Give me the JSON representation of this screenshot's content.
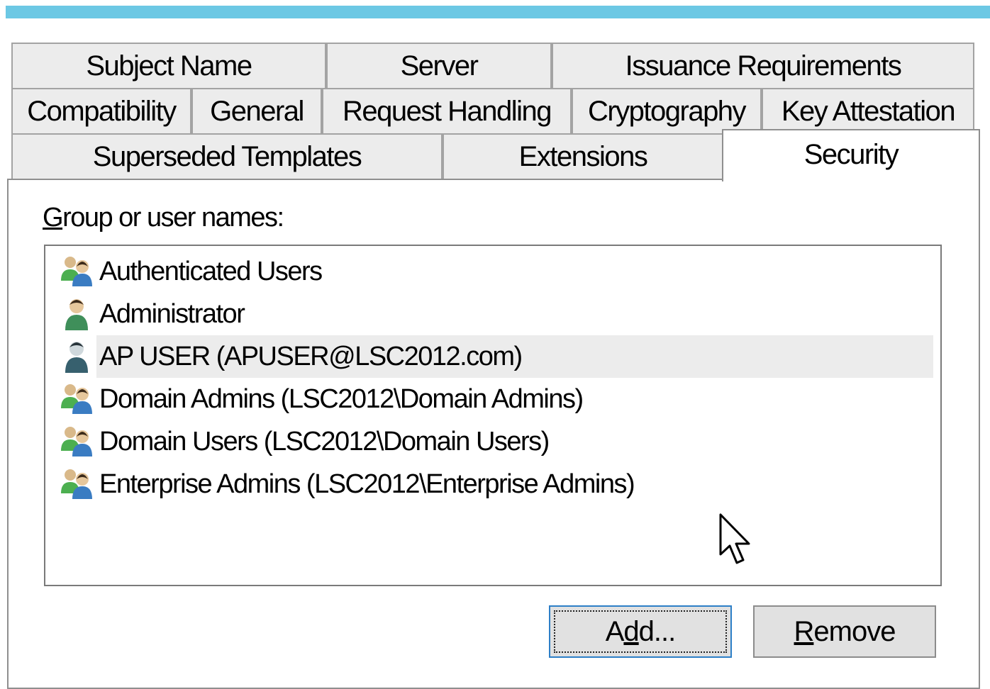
{
  "tabs": {
    "row1": [
      {
        "label": "Subject Name"
      },
      {
        "label": "Server"
      },
      {
        "label": "Issuance Requirements"
      }
    ],
    "row2": [
      {
        "label": "Compatibility"
      },
      {
        "label": "General"
      },
      {
        "label": "Request Handling"
      },
      {
        "label": "Cryptography"
      },
      {
        "label": "Key Attestation"
      }
    ],
    "row3": [
      {
        "label": "Superseded Templates"
      },
      {
        "label": "Extensions"
      },
      {
        "label": "Security",
        "active": true
      }
    ]
  },
  "security": {
    "group_label_mnemonic": "G",
    "group_label_rest": "roup or user names:",
    "principals": [
      {
        "label": "Authenticated Users",
        "icon": "group-users-icon"
      },
      {
        "label": "Administrator",
        "icon": "user-icon"
      },
      {
        "label": "AP USER (APUSER@LSC2012.com)",
        "icon": "user-icon",
        "selected": true
      },
      {
        "label": "Domain Admins (LSC2012\\Domain Admins)",
        "icon": "group-users-icon"
      },
      {
        "label": "Domain Users (LSC2012\\Domain Users)",
        "icon": "group-users-icon"
      },
      {
        "label": "Enterprise Admins (LSC2012\\Enterprise Admins)",
        "icon": "group-users-icon"
      }
    ],
    "add_button": {
      "pre": "A",
      "mnemonic": "d",
      "post": "d..."
    },
    "remove_button": {
      "mnemonic": "R",
      "post": "emove"
    }
  },
  "colors": {
    "title_bar": "#6cc8e4",
    "tab_bg": "#ececec",
    "selection_bg": "#ececec",
    "default_button_border": "#2d7fc7"
  }
}
